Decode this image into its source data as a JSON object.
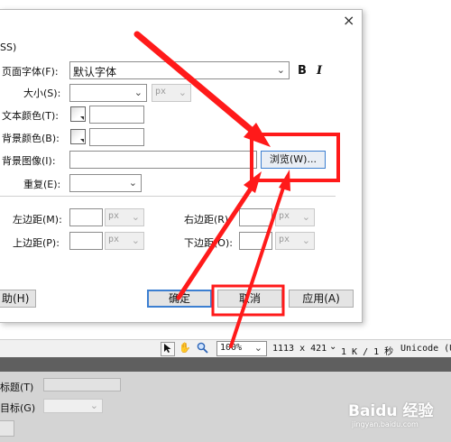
{
  "dialog": {
    "title_fragment": "SS)",
    "close_glyph": "×",
    "page_font": {
      "label": "页面字体(F):",
      "value": "默认字体",
      "bold_label": "B",
      "italic_label": "I"
    },
    "size": {
      "label": "大小(S):",
      "unit": "px"
    },
    "text_color": {
      "label": "文本颜色(T):"
    },
    "bg_color": {
      "label": "背景颜色(B):"
    },
    "bg_image": {
      "label": "背景图像(I):",
      "browse_label": "浏览(W)..."
    },
    "repeat": {
      "label": "重复(E):"
    },
    "margins": {
      "left": {
        "label": "左边距(M):",
        "unit": "px"
      },
      "right": {
        "label": "右边距(R):",
        "unit": "px"
      },
      "top": {
        "label": "上边距(P):",
        "unit": "px"
      },
      "bottom": {
        "label": "下边距(O):",
        "unit": "px"
      }
    },
    "buttons": {
      "help": "助(H)",
      "ok": "确定",
      "cancel": "取消",
      "apply": "应用(A)"
    }
  },
  "statusbar": {
    "zoom": "100%",
    "dimensions": "1113 x 421",
    "size_time": "1 K / 1 秒",
    "encoding": "Unicode (U"
  },
  "props": {
    "title_label": "标题(T)",
    "target_label": "目标(G)"
  },
  "watermark": {
    "brand": "Baidu 经验",
    "url": "jingyan.baidu.com"
  },
  "colors": {
    "annotation_red": "#ff1a1a",
    "accent_blue": "#3c7fd1"
  }
}
